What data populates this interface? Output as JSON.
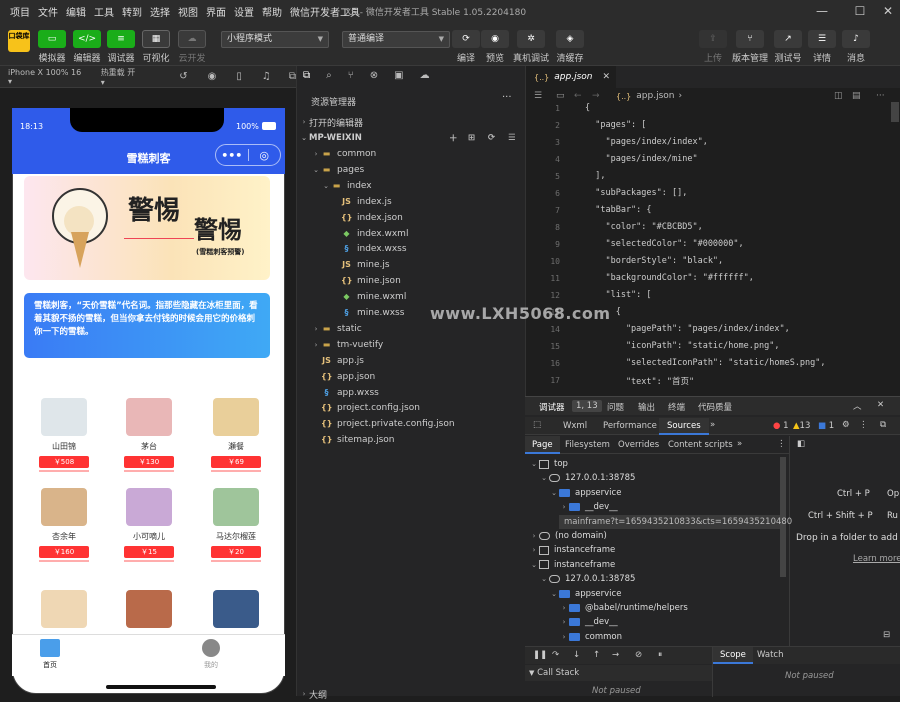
{
  "menu": [
    "项目",
    "文件",
    "编辑",
    "工具",
    "转到",
    "选择",
    "视图",
    "界面",
    "设置",
    "帮助",
    "微信开发者工具"
  ],
  "window_title": "XS - 微信开发者工具 Stable 1.05.2204180",
  "toolbar": {
    "logo": "口袋库",
    "buttons": [
      "模拟器",
      "编辑器",
      "调试器",
      "可视化",
      "云开发"
    ],
    "mode_select": "小程序模式",
    "compile_select": "普通编译",
    "actions": [
      "编译",
      "预览",
      "真机调试",
      "清缓存"
    ],
    "right": [
      "上传",
      "版本管理",
      "测试号",
      "详情",
      "消息"
    ]
  },
  "subbar": {
    "device": "iPhone X 100% 16 ▾",
    "hotreload": "热重载 开 ▾"
  },
  "phone": {
    "time": "18:13",
    "battery": "100%",
    "title": "雪糕刺客",
    "banner_text1": "警惕",
    "banner_text2": "警惕",
    "banner_sub": "(雪糕刺客预警)",
    "notice": "雪糕刺客，“天价雪糕”代名词。指那些隐藏在冰柜里面，看着其貌不扬的雪糕，但当你拿去付钱的时候会用它的价格刺你一下的雪糕。",
    "products": [
      {
        "name": "山田锦",
        "price": "￥508",
        "color": "#dfe6ea"
      },
      {
        "name": "茅台",
        "price": "￥130",
        "color": "#e9b7b7"
      },
      {
        "name": "瀬餐",
        "price": "￥69",
        "color": "#e9cf9a"
      },
      {
        "name": "杏余年",
        "price": "￥160",
        "color": "#d9b48a"
      },
      {
        "name": "小可嘀儿",
        "price": "￥15",
        "color": "#c9a9d6"
      },
      {
        "name": "马达尔榴莲",
        "price": "￥20",
        "color": "#9fc59b"
      },
      {
        "name": "",
        "price": "",
        "color": "#efd7b4"
      },
      {
        "name": "",
        "price": "",
        "color": "#b96a4a"
      },
      {
        "name": "",
        "price": "",
        "color": "#3a5b8a"
      }
    ],
    "tabs": [
      {
        "label": "首页",
        "active": true
      },
      {
        "label": "我的",
        "active": false
      }
    ]
  },
  "explorer": {
    "title": "资源管理器",
    "open_editors": "打开的编辑器",
    "project": "MP-WEIXIN",
    "items": [
      {
        "label": "common",
        "depth": 1,
        "type": "folder",
        "arrow": "›"
      },
      {
        "label": "pages",
        "depth": 1,
        "type": "folder-open",
        "arrow": "⌄"
      },
      {
        "label": "index",
        "depth": 2,
        "type": "folder-open",
        "arrow": "⌄"
      },
      {
        "label": "index.js",
        "depth": 3,
        "type": "js"
      },
      {
        "label": "index.json",
        "depth": 3,
        "type": "json"
      },
      {
        "label": "index.wxml",
        "depth": 3,
        "type": "wxml"
      },
      {
        "label": "index.wxss",
        "depth": 3,
        "type": "wxss"
      },
      {
        "label": "mine.js",
        "depth": 3,
        "type": "js"
      },
      {
        "label": "mine.json",
        "depth": 3,
        "type": "json"
      },
      {
        "label": "mine.wxml",
        "depth": 3,
        "type": "wxml"
      },
      {
        "label": "mine.wxss",
        "depth": 3,
        "type": "wxss"
      },
      {
        "label": "static",
        "depth": 1,
        "type": "folder",
        "arrow": "›"
      },
      {
        "label": "tm-vuetify",
        "depth": 1,
        "type": "folder",
        "arrow": "›"
      },
      {
        "label": "app.js",
        "depth": 1,
        "type": "js"
      },
      {
        "label": "app.json",
        "depth": 1,
        "type": "json"
      },
      {
        "label": "app.wxss",
        "depth": 1,
        "type": "wxss"
      },
      {
        "label": "project.config.json",
        "depth": 1,
        "type": "json"
      },
      {
        "label": "project.private.config.json",
        "depth": 1,
        "type": "json"
      },
      {
        "label": "sitemap.json",
        "depth": 1,
        "type": "json"
      }
    ],
    "bottom": "大纲"
  },
  "editor": {
    "tab": "app.json",
    "breadcrumb": "app.json",
    "lines": [
      "{",
      "  \"pages\": [",
      "    \"pages/index/index\",",
      "    \"pages/index/mine\"",
      "  ],",
      "  \"subPackages\": [],",
      "  \"tabBar\": {",
      "    \"color\": \"#CBCBD5\",",
      "    \"selectedColor\": \"#000000\",",
      "    \"borderStyle\": \"black\",",
      "    \"backgroundColor\": \"#ffffff\",",
      "    \"list\": [",
      "      {",
      "        \"pagePath\": \"pages/index/index\",",
      "        \"iconPath\": \"static/home.png\",",
      "        \"selectedIconPath\": \"static/homeS.png\",",
      "        \"text\": \"首页\""
    ]
  },
  "devtools": {
    "tabs": [
      "调试器",
      "1, 13",
      "问题",
      "输出",
      "终端",
      "代码质量"
    ],
    "panels": [
      "Wxml",
      "Performance",
      "Sources"
    ],
    "errors": "1",
    "warnings": "13",
    "info": "1",
    "subtabs": [
      "Page",
      "Filesystem",
      "Overrides",
      "Content scripts"
    ],
    "nodes": [
      {
        "label": "top",
        "depth": 0,
        "icon": "frame",
        "arrow": "⌄"
      },
      {
        "label": "127.0.0.1:38785",
        "depth": 1,
        "icon": "cloud",
        "arrow": "⌄"
      },
      {
        "label": "appservice",
        "depth": 2,
        "icon": "folder",
        "arrow": "⌄"
      },
      {
        "label": "__dev__",
        "depth": 3,
        "icon": "folder",
        "arrow": "›"
      },
      {
        "label": "mainframe?t=1659435210833&cts=1659435210480",
        "depth": 3,
        "icon": "file",
        "arrow": ""
      },
      {
        "label": "(no domain)",
        "depth": 0,
        "icon": "cloud",
        "arrow": "›"
      },
      {
        "label": "instanceframe",
        "depth": 0,
        "icon": "frame",
        "arrow": "›"
      },
      {
        "label": "instanceframe",
        "depth": 0,
        "icon": "frame",
        "arrow": "⌄"
      },
      {
        "label": "127.0.0.1:38785",
        "depth": 1,
        "icon": "cloud",
        "arrow": "⌄"
      },
      {
        "label": "appservice",
        "depth": 2,
        "icon": "folder",
        "arrow": "⌄"
      },
      {
        "label": "@babel/runtime/helpers",
        "depth": 3,
        "icon": "folder",
        "arrow": "›"
      },
      {
        "label": "__dev__",
        "depth": 3,
        "icon": "folder",
        "arrow": "›"
      },
      {
        "label": "common",
        "depth": 3,
        "icon": "folder",
        "arrow": "›"
      }
    ],
    "shortcuts": [
      [
        "Ctrl + P",
        "Op"
      ],
      [
        "Ctrl + Shift + P",
        "Ru"
      ]
    ],
    "drop_hint": "Drop in a folder to add",
    "learn_more": "Learn more",
    "call_stack": "Call Stack",
    "not_paused": "Not paused",
    "scope": "Scope",
    "watch": "Watch"
  },
  "watermark": "www.LXH5068.com"
}
